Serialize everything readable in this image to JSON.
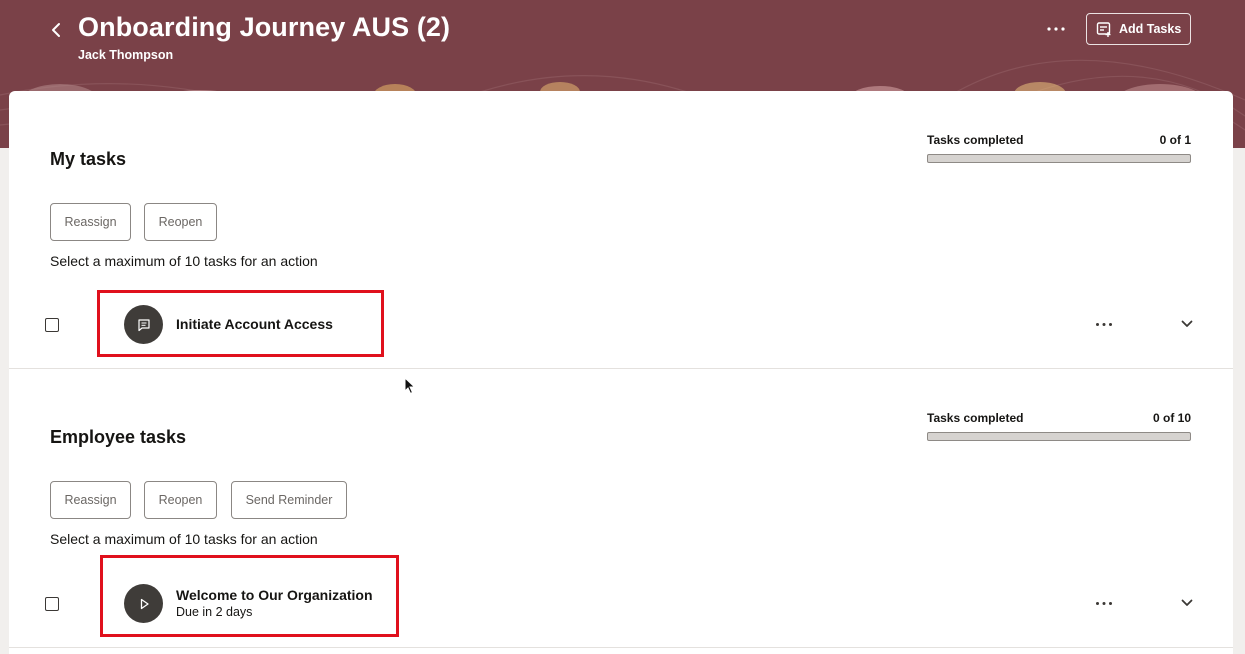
{
  "header": {
    "title": "Onboarding Journey AUS (2)",
    "subtitle": "Jack Thompson",
    "add_tasks_label": "Add Tasks",
    "back_icon": "chevron-left-icon",
    "more_icon": "more-horizontal-icon",
    "add_tasks_icon": "add-list-icon",
    "banner_color": "#7a4148"
  },
  "my_tasks": {
    "title": "My tasks",
    "progress_label": "Tasks completed",
    "progress_count": "0 of 1",
    "progress_fraction": 0,
    "buttons": [
      "Reassign",
      "Reopen"
    ],
    "hint": "Select a maximum of 10 tasks for an action",
    "tasks": [
      {
        "name": "Initiate Account Access",
        "due": "",
        "icon": "comment-icon",
        "checked": false
      }
    ]
  },
  "employee_tasks": {
    "title": "Employee tasks",
    "progress_label": "Tasks completed",
    "progress_count": "0 of 10",
    "progress_fraction": 0,
    "buttons": [
      "Reassign",
      "Reopen",
      "Send Reminder"
    ],
    "hint": "Select a maximum of 10 tasks for an action",
    "tasks": [
      {
        "name": "Welcome to Our Organization",
        "due": "Due in 2 days",
        "icon": "play-icon",
        "checked": false
      }
    ]
  },
  "colors": {
    "highlight": "#e0101c",
    "avatar": "#3f3c39"
  }
}
